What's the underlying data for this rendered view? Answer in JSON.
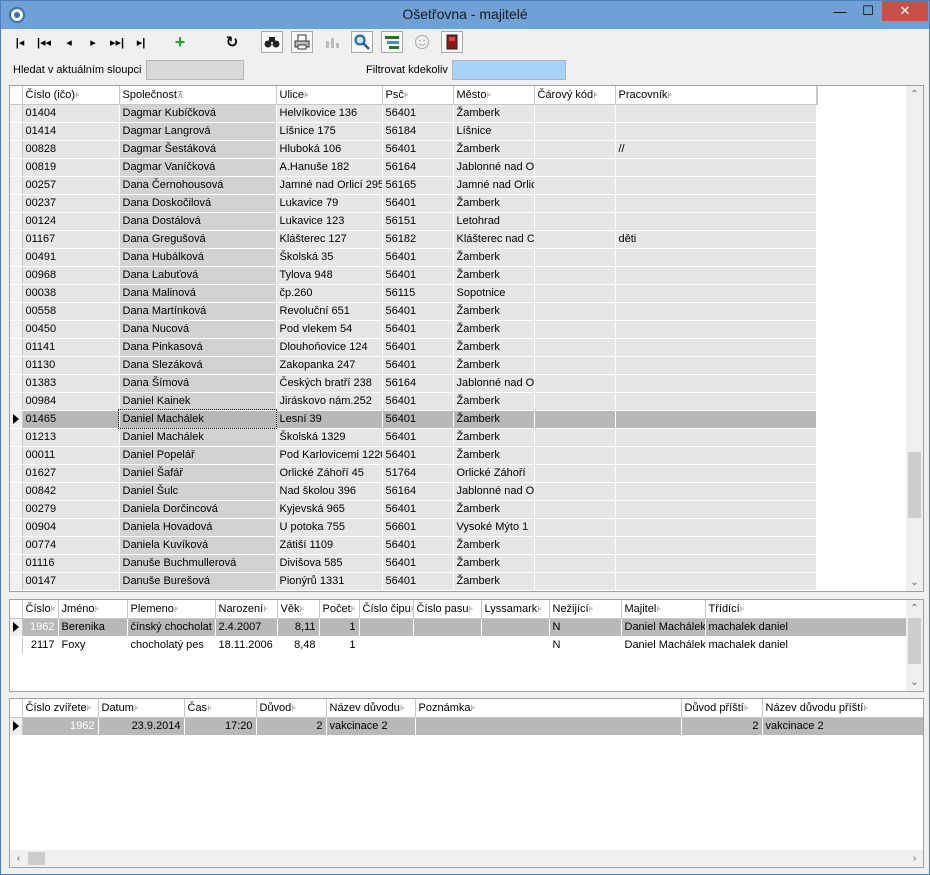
{
  "window": {
    "title": "Ošetřovna - majitelé"
  },
  "titlebar": {
    "minimize": "—",
    "maximize": "☐",
    "close": "✕"
  },
  "toolbar": {
    "first": "|◂",
    "prev_page": "|◂◂",
    "prev": "◂",
    "next": "▸",
    "next_page": "▸▸|",
    "last": "▸|",
    "add": "+",
    "refresh": "↻"
  },
  "search": {
    "column_label": "Hledat v aktuálním sloupci",
    "column_value": "",
    "anywhere_label": "Filtrovat kdekoliv",
    "anywhere_value": ""
  },
  "owners": {
    "columns": [
      "Číslo (ičo)",
      "Společnost",
      "Ulice",
      "Psč",
      "Město",
      "Čárový kód",
      "Pracovník"
    ],
    "rows": [
      [
        "01404",
        "Dagmar Kubíčková",
        "Helvíkovice 136",
        "56401",
        "Žamberk",
        "",
        ""
      ],
      [
        "01414",
        "Dagmar Langrová",
        "Líšnice 175",
        "56184",
        "Líšnice",
        "",
        ""
      ],
      [
        "00828",
        "Dagmar Šestáková",
        "Hluboká 106",
        "56401",
        "Žamberk",
        "",
        "//"
      ],
      [
        "00819",
        "Dagmar Vaníčková",
        "A.Hanuše 182",
        "56164",
        "Jablonné nad O",
        "",
        ""
      ],
      [
        "00257",
        "Dana Černohousová",
        "Jamné nad Orlicí 295",
        "56165",
        "Jamné nad Orlic",
        "",
        ""
      ],
      [
        "00237",
        "Dana Doskočilová",
        "Lukavice 79",
        "56401",
        "Žamberk",
        "",
        ""
      ],
      [
        "00124",
        "Dana Dostálová",
        "Lukavice 123",
        "56151",
        "Letohrad",
        "",
        ""
      ],
      [
        "01167",
        "Dana Gregušová",
        "Klášterec 127",
        "56182",
        "Klášterec nad C",
        "",
        "děti"
      ],
      [
        "00491",
        "Dana Hubálková",
        "Školská 35",
        "56401",
        "Žamberk",
        "",
        ""
      ],
      [
        "00968",
        "Dana Labuťová",
        "Tylova 948",
        "56401",
        "Žamberk",
        "",
        ""
      ],
      [
        "00038",
        "Dana Malinová",
        "čp.260",
        "56115",
        "Sopotnice",
        "",
        ""
      ],
      [
        "00558",
        "Dana Martínková",
        "Revoluční 651",
        "56401",
        "Žamberk",
        "",
        ""
      ],
      [
        "00450",
        "Dana Nucová",
        "Pod vlekem 54",
        "56401",
        "Žamberk",
        "",
        ""
      ],
      [
        "01141",
        "Dana Pinkasová",
        "Dlouhoňovice 124",
        "56401",
        "Žamberk",
        "",
        ""
      ],
      [
        "01130",
        "Dana Slezáková",
        "Zakopanka 247",
        "56401",
        "Žamberk",
        "",
        ""
      ],
      [
        "01383",
        "Dana Šímová",
        "Českých bratří 238",
        "56164",
        "Jablonné nad O",
        "",
        ""
      ],
      [
        "00984",
        "Daniel Kainek",
        "Jiráskovo nám.252",
        "56401",
        "Žamberk",
        "",
        ""
      ],
      [
        "01465",
        "Daniel Machálek",
        "Lesní 39",
        "56401",
        "Žamberk",
        "",
        ""
      ],
      [
        "01213",
        "Daniel Machálek",
        "Školská 1329",
        "56401",
        "Žamberk",
        "",
        ""
      ],
      [
        "00011",
        "Daniel Popelář",
        "Pod Karlovicemi 1220",
        "56401",
        "Žamberk",
        "",
        ""
      ],
      [
        "01627",
        "Daniel Šafář",
        "Orlické Záhoří 45",
        "51764",
        "Orlické Záhoří",
        "",
        ""
      ],
      [
        "00842",
        "Daniel Šulc",
        "Nad školou 396",
        "56164",
        "Jablonné nad O",
        "",
        ""
      ],
      [
        "00279",
        "Daniela Dorčincová",
        "Kyjevská 965",
        "56401",
        "Žamberk",
        "",
        ""
      ],
      [
        "00904",
        "Daniela Hovadová",
        "U potoka 755",
        "56601",
        "Vysoké Mýto 1",
        "",
        ""
      ],
      [
        "00774",
        "Daniela Kuvíková",
        "Zátiší 1109",
        "56401",
        "Žamberk",
        "",
        ""
      ],
      [
        "01116",
        "Danuše Buchmullerová",
        "Divišova 585",
        "56401",
        "Žamberk",
        "",
        ""
      ],
      [
        "00147",
        "Danuše Burešová",
        "Pionýrů 1331",
        "56401",
        "Žamberk",
        "",
        ""
      ]
    ]
  },
  "animals": {
    "columns": [
      "Číslo",
      "Jméno",
      "Plemeno",
      "Narození",
      "Věk",
      "Počet",
      "Číslo čipu",
      "Číslo pasu",
      "Lyssamark",
      "Nežijící",
      "Majitel",
      "Třídící"
    ],
    "rows": [
      [
        "1962",
        "Berenika",
        "čínský chocholat",
        "2.4.2007",
        "8,11",
        "1",
        "",
        "",
        "",
        "N",
        "Daniel Machálek",
        "machalek daniel"
      ],
      [
        "2117",
        "Foxy",
        "chocholatý pes",
        "18.11.2006",
        "8,48",
        "1",
        "",
        "",
        "",
        "N",
        "Daniel Machálek",
        "machalek daniel"
      ]
    ]
  },
  "visits": {
    "columns": [
      "Číslo zvířete",
      "Datum",
      "Čas",
      "Důvod",
      "Název důvodu",
      "Poznámka",
      "Důvod příští",
      "Název důvodu příští"
    ],
    "rows": [
      [
        "1962",
        "23.9.2014",
        "17:20",
        "2",
        "vakcinace 2",
        "",
        "2",
        "vakcinace 2"
      ]
    ]
  }
}
